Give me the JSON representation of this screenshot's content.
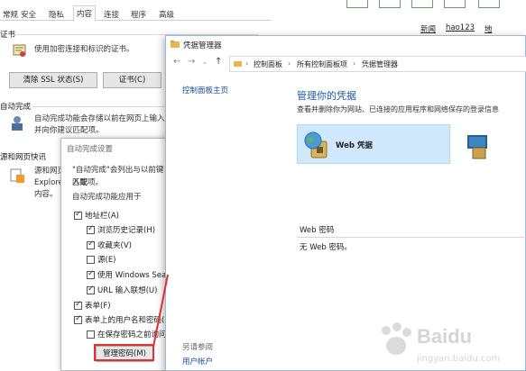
{
  "internet_options": {
    "tabs": [
      "常规",
      "安全",
      "隐私",
      "内容",
      "连接",
      "程序",
      "高级"
    ],
    "active_tab": "内容",
    "certificates": {
      "title": "证书",
      "desc": "使用加密连接和标识的证书。",
      "clear_ssl_button": "清除 SSL 状态(S)",
      "certs_button": "证书(C)"
    },
    "autocomplete": {
      "title": "自动完成",
      "desc_line1": "自动完成功能会存储以前在网页上输入的",
      "desc_line2": "并向你建议匹配项。"
    },
    "feeds": {
      "title": "源和网页快讯",
      "desc_line1": "源和网页",
      "desc_line2": "Explore",
      "desc_line3": "内容。"
    }
  },
  "autocomplete_dialog": {
    "title": "自动完成设置",
    "intro_line1": "\"自动完成\"会列出与以前键入或",
    "intro_line2": "匹配项。",
    "group_label": "自动完成功能应用于",
    "options": [
      {
        "label": "地址栏(A)",
        "checked": true
      },
      {
        "label": "浏览历史记录(H)",
        "checked": true
      },
      {
        "label": "收藏夹(V)",
        "checked": true
      },
      {
        "label": "源(E)",
        "checked": false
      },
      {
        "label": "使用 Windows Search",
        "checked": true
      },
      {
        "label": "URL 输入联想(U)",
        "checked": true
      },
      {
        "label": "表单(F)",
        "checked": true
      },
      {
        "label": "表单上的用户名和密码(P)",
        "checked": true
      },
      {
        "label": "在保存密码之前询问我",
        "checked": false
      }
    ],
    "manage_passwords_button": "管理密码(M)"
  },
  "browser_bar": {
    "links": [
      "新闻",
      "hao123",
      "地"
    ]
  },
  "credential_manager": {
    "title": "凭据管理器",
    "breadcrumbs": [
      "控制面板",
      "所有控制面板项",
      "凭据管理器"
    ],
    "left_link": "控制面板主页",
    "heading": "管理你的凭据",
    "subtitle": "查看并删除你为网站、已连接的应用程序和网络保存的登录信息",
    "web_credentials_label": "Web 凭据",
    "section_label": "Web 密码",
    "empty_text": "无 Web 密码。",
    "see_also": "另请参阅",
    "user_accounts_link": "用户帐户",
    "colors": {
      "selected_tile": "#cfe8fb",
      "heading": "#1e5aa8"
    }
  },
  "watermark": {
    "brand": "Baidu",
    "sub": "jingyan.baidu.com"
  }
}
